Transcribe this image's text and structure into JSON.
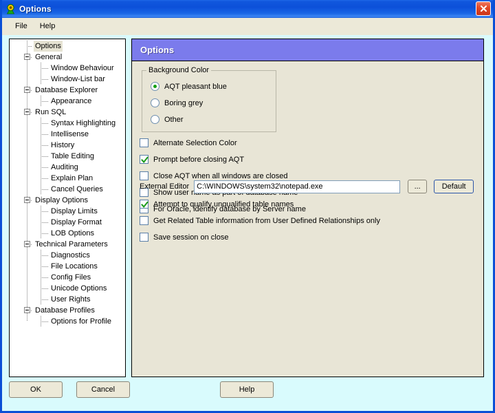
{
  "window": {
    "title": "Options",
    "icon": "app-magnifier-icon",
    "close_label": "×",
    "border_color": "#0a4fd6",
    "titlebar_color": "#0c50d9",
    "body_color": "#d9fbfd"
  },
  "menubar": {
    "items": [
      {
        "label": "File"
      },
      {
        "label": "Help"
      }
    ]
  },
  "tree": {
    "items": [
      {
        "label": "Options",
        "level": 1,
        "expandable": false,
        "selected": true
      },
      {
        "label": "General",
        "level": 0,
        "expandable": true,
        "selected": false
      },
      {
        "label": "Window Behaviour",
        "level": 2,
        "expandable": false,
        "selected": false
      },
      {
        "label": "Window-List bar",
        "level": 2,
        "expandable": false,
        "selected": false
      },
      {
        "label": "Database Explorer",
        "level": 0,
        "expandable": true,
        "selected": false
      },
      {
        "label": "Appearance",
        "level": 2,
        "expandable": false,
        "selected": false
      },
      {
        "label": "Run SQL",
        "level": 0,
        "expandable": true,
        "selected": false
      },
      {
        "label": "Syntax Highlighting",
        "level": 2,
        "expandable": false,
        "selected": false
      },
      {
        "label": "Intellisense",
        "level": 2,
        "expandable": false,
        "selected": false
      },
      {
        "label": "History",
        "level": 2,
        "expandable": false,
        "selected": false
      },
      {
        "label": "Table Editing",
        "level": 2,
        "expandable": false,
        "selected": false
      },
      {
        "label": "Auditing",
        "level": 2,
        "expandable": false,
        "selected": false
      },
      {
        "label": "Explain Plan",
        "level": 2,
        "expandable": false,
        "selected": false
      },
      {
        "label": "Cancel Queries",
        "level": 2,
        "expandable": false,
        "selected": false
      },
      {
        "label": "Display Options",
        "level": 0,
        "expandable": true,
        "selected": false
      },
      {
        "label": "Display Limits",
        "level": 2,
        "expandable": false,
        "selected": false
      },
      {
        "label": "Display Format",
        "level": 2,
        "expandable": false,
        "selected": false
      },
      {
        "label": "LOB Options",
        "level": 2,
        "expandable": false,
        "selected": false
      },
      {
        "label": "Technical Parameters",
        "level": 0,
        "expandable": true,
        "selected": false
      },
      {
        "label": "Diagnostics",
        "level": 2,
        "expandable": false,
        "selected": false
      },
      {
        "label": "File Locations",
        "level": 2,
        "expandable": false,
        "selected": false
      },
      {
        "label": "Config Files",
        "level": 2,
        "expandable": false,
        "selected": false
      },
      {
        "label": "Unicode Options",
        "level": 2,
        "expandable": false,
        "selected": false
      },
      {
        "label": "User Rights",
        "level": 2,
        "expandable": false,
        "selected": false
      },
      {
        "label": "Database Profiles",
        "level": 0,
        "expandable": true,
        "selected": false
      },
      {
        "label": "Options for Profile",
        "level": 2,
        "expandable": false,
        "selected": false
      }
    ]
  },
  "panel": {
    "header_title": "Options",
    "header_color": "#7b7bec",
    "background_color": "#e8e5d6",
    "background_group": {
      "title": "Background Color",
      "options": [
        {
          "label": "AQT pleasant blue",
          "checked": true
        },
        {
          "label": "Boring grey",
          "checked": false
        },
        {
          "label": "Other",
          "checked": false
        }
      ]
    },
    "checkboxes_top": [
      {
        "label": "Alternate Selection Color",
        "checked": false
      },
      {
        "label": "Prompt before closing AQT",
        "checked": true
      },
      {
        "label": "Close AQT when all windows are closed",
        "checked": false
      },
      {
        "label": "Show user name as part of database name",
        "checked": false
      },
      {
        "label": "For Oracle, identify database by Server name",
        "checked": false
      }
    ],
    "external_editor": {
      "label": "External Editor",
      "value": "C:\\WINDOWS\\system32\\notepad.exe",
      "placeholder": "",
      "browse_label": "...",
      "default_label": "Default"
    },
    "checkboxes_bottom": [
      {
        "label": "Attempt to qualify unqualified table names",
        "checked": true
      },
      {
        "label": "Get Related Table information from User Defined Relationships only",
        "checked": false
      },
      {
        "label": "Save session on close",
        "checked": false
      }
    ]
  },
  "buttons": {
    "ok": "OK",
    "cancel": "Cancel",
    "help": "Help"
  }
}
